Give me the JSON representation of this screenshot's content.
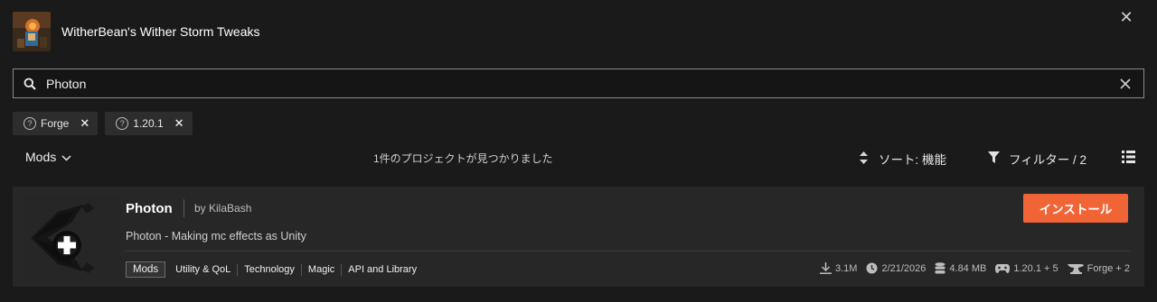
{
  "modpack": {
    "title": "WitherBean's Wither Storm Tweaks"
  },
  "search": {
    "value": "Photon",
    "placeholder": ""
  },
  "filters": [
    {
      "label": "Forge"
    },
    {
      "label": "1.20.1"
    }
  ],
  "toolbar": {
    "category": "Mods",
    "results_text": "1件のプロジェクトが見つかりました",
    "sort_label": "ソート: 機能",
    "filter_label": "フィルター / 2"
  },
  "result": {
    "name": "Photon",
    "author": "by KilaBash",
    "description": "Photon - Making mc effects as Unity",
    "install_label": "インストール",
    "primary_tag": "Mods",
    "tags": [
      "Utility & QoL",
      "Technology",
      "Magic",
      "API and Library"
    ],
    "downloads": "3.1M",
    "updated": "2/21/2026",
    "size": "4.84 MB",
    "versions": "1.20.1 + 5",
    "loaders": "Forge + 2"
  },
  "colors": {
    "accent": "#f16436",
    "background": "#1a1a1a",
    "card": "#272727"
  }
}
